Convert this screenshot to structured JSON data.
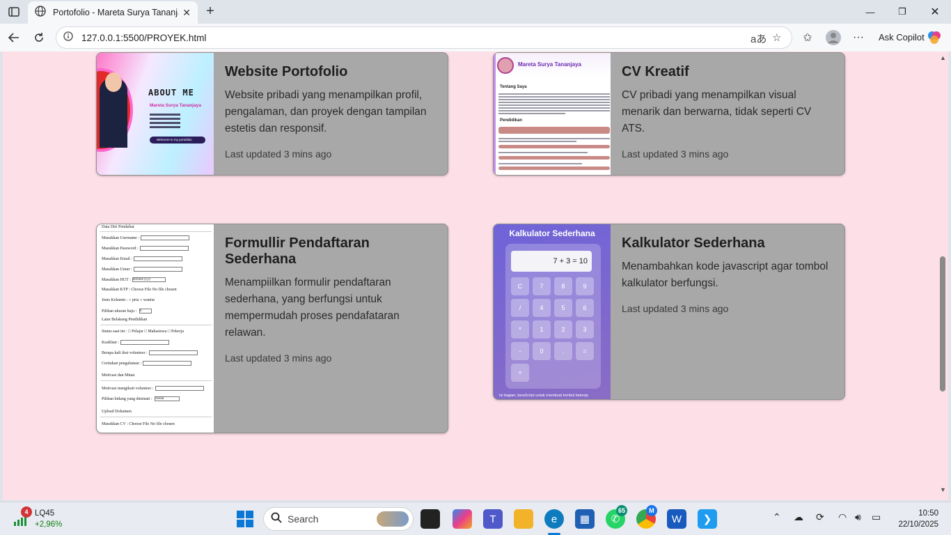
{
  "browser": {
    "tab_title": "Portofolio - Mareta Surya Tananjaya",
    "url": "127.0.0.1:5500/PROYEK.html",
    "ask_copilot": "Ask Copilot"
  },
  "projects": [
    {
      "title": "Website Portofolio",
      "description": "Website pribadi yang menampilkan profil, pengalaman, dan proyek dengan tampilan estetis dan responsif.",
      "updated": "Last updated 3 mins ago",
      "thumb": {
        "heading": "ABOUT ME",
        "name": "Mareta Surya Tananjaya",
        "button": "Welcome to my portofolio"
      }
    },
    {
      "title": "CV Kreatif",
      "description": "CV pribadi yang menampilkan visual menarik dan berwarna, tidak seperti CV ATS.",
      "updated": "Last updated 3 mins ago",
      "thumb": {
        "name": "Mareta Surya Tananjaya",
        "section1": "Tentang Saya",
        "section2": "Pendidikan"
      }
    },
    {
      "title": "Formullir Pendaftaran Sederhana",
      "description": "Menampiilkan formulir pendaftaran sederhana, yang berfungsi untuk mempermudah proses pendafataran relawan.",
      "updated": "Last updated 3 mins ago",
      "thumb": {
        "h1": "Data Diri Pendaftar",
        "f1": "Masukkan Username :",
        "f2": "Masukkan Password :",
        "f3": "Masukkan Email :",
        "f4": "Masukkan Umur :",
        "f5": "Masukkan HUT :",
        "f5v": "dd/mm/yyyy",
        "f6": "Masukkan KTP :",
        "f6v": "Choose File  No file chosen",
        "f7": "Jenis Kelamin :  ○ pria  ○ wanita",
        "f8": "Pilihan ukuran baju :",
        "f8v": "S",
        "h2": "Latar Belakang Pendidikan",
        "f9": "Status saat ini : □ Pelajar □ Mahasiswa □ Pekerja",
        "f10": "Keahlian :",
        "f11": "Berapa kali ikut volunteer :",
        "f12": "Ceritakan pengalaman :",
        "h3": "Motivasi dan Minat",
        "f13": "Motivasi mengikuti volunteer :",
        "f14": "Pilihan bidang yang diminati :",
        "f14v": "Sosial",
        "h4": "Upload Dokumen",
        "f15": "Masukkan CV :",
        "f15v": "Choose File  No file chosen"
      }
    },
    {
      "title": "Kalkulator Sederhana",
      "description": "Menambahkan kode javascript agar tombol kalkulator berfungsi.",
      "updated": "Last updated 3 mins ago",
      "thumb": {
        "title": "Kalkulator Sederhana",
        "display": "7 + 3 = 10",
        "keys": [
          "C",
          "7",
          "8",
          "9",
          "/",
          "4",
          "5",
          "6",
          "*",
          "1",
          "2",
          "3",
          "-",
          "0",
          ".",
          "=",
          "+"
        ],
        "note": "Isi bagian JavaScript untuk membuat tombol bekerja"
      }
    }
  ],
  "taskbar": {
    "stock_name": "LQ45",
    "stock_change": "+2,96%",
    "stock_badge": "4",
    "search_label": "Search",
    "whatsapp_badge": "65",
    "copilot_badge": "M",
    "time": "10:50",
    "date": "22/10/2025"
  }
}
